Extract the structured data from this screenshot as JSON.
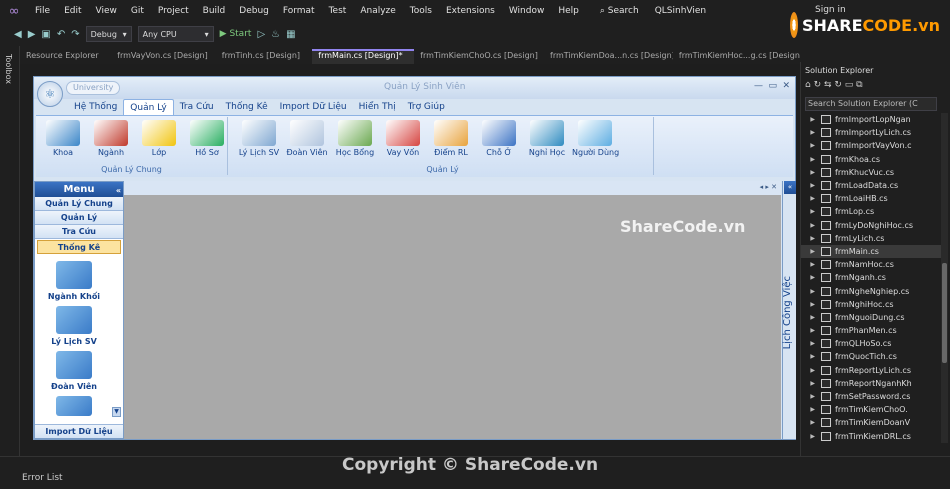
{
  "menubar": {
    "items": [
      "File",
      "Edit",
      "View",
      "Git",
      "Project",
      "Build",
      "Debug",
      "Format",
      "Test",
      "Analyze",
      "Tools",
      "Extensions",
      "Window",
      "Help"
    ],
    "search": "Search",
    "solution": "QLSinhVien",
    "signin": "Sign in"
  },
  "toolbar": {
    "config": "Debug",
    "platform": "Any CPU",
    "start": "Start"
  },
  "toolbox_label": "Toolbox",
  "doctabs": [
    {
      "label": "Resource Explorer",
      "active": false
    },
    {
      "label": "frmVayVon.cs [Design]",
      "active": false
    },
    {
      "label": "frmTinh.cs [Design]",
      "active": false
    },
    {
      "label": "frmMain.cs [Design]*",
      "active": true
    },
    {
      "label": "frmTimKiemChoO.cs [Design]",
      "active": false
    },
    {
      "label": "frmTimKiemDoa...n.cs [Design]",
      "active": false
    },
    {
      "label": "frmTimKiemHoc...g.cs [Design]",
      "active": false
    }
  ],
  "app": {
    "title": "Quản Lý Sinh Viên",
    "univ": "University",
    "ribbon_tabs": [
      "Hệ Thống",
      "Quản Lý",
      "Tra Cứu",
      "Thống Kê",
      "Import Dữ Liệu",
      "Hiển Thị",
      "Trợ Giúp"
    ],
    "active_tab": "Quản Lý",
    "group1": {
      "label": "Quản Lý Chung",
      "buttons": [
        "Khoa",
        "Ngành",
        "Lớp",
        "Hồ Sơ"
      ]
    },
    "group2": {
      "label": "Quản Lý",
      "buttons": [
        "Lý Lịch SV",
        "Đoàn Viên",
        "Học Bổng",
        "Vay Vốn",
        "Điểm RL",
        "Chỗ Ở",
        "Nghỉ Học",
        "Người Dùng"
      ]
    },
    "menu": {
      "title": "Menu",
      "sections": [
        "Quản Lý Chung",
        "Quản Lý",
        "Tra Cứu",
        "Thống Kê"
      ],
      "selected": "Thống Kê",
      "items": [
        "Ngành Khối",
        "Lý Lịch SV",
        "Đoàn Viên"
      ],
      "bottom": "Import Dữ Liệu"
    },
    "right_panel": "Lịch Công Việc"
  },
  "solution_explorer": {
    "title": "Solution Explorer",
    "search": "Search Solution Explorer (C",
    "files": [
      "frmImportLopNgan",
      "frmImportLyLich.cs",
      "frmImportVayVon.c",
      "frmKhoa.cs",
      "frmKhucVuc.cs",
      "frmLoadData.cs",
      "frmLoaiHB.cs",
      "frmLop.cs",
      "frmLyDoNghiHoc.cs",
      "frmLyLich.cs",
      "frmMain.cs",
      "frmNamHoc.cs",
      "frmNganh.cs",
      "frmNgheNghiep.cs",
      "frmNghiHoc.cs",
      "frmNguoiDung.cs",
      "frmPhanMen.cs",
      "frmQLHoSo.cs",
      "frmQuocTich.cs",
      "frmReportLyLich.cs",
      "frmReportNganhKh",
      "frmSetPassword.cs",
      "frmTimKiemChoO.",
      "frmTimKiemDoanV",
      "frmTimKiemDRL.cs"
    ],
    "selected": "frmMain.cs"
  },
  "bottom": {
    "error_list": "Error List"
  },
  "watermarks": {
    "logo_a": "SHARE",
    "logo_b": "CODE.vn",
    "center": "ShareCode.vn",
    "copyright": "Copyright © ShareCode.vn"
  },
  "colors": {
    "accent": "#9184ee",
    "ribbon_text": "#15428b"
  }
}
